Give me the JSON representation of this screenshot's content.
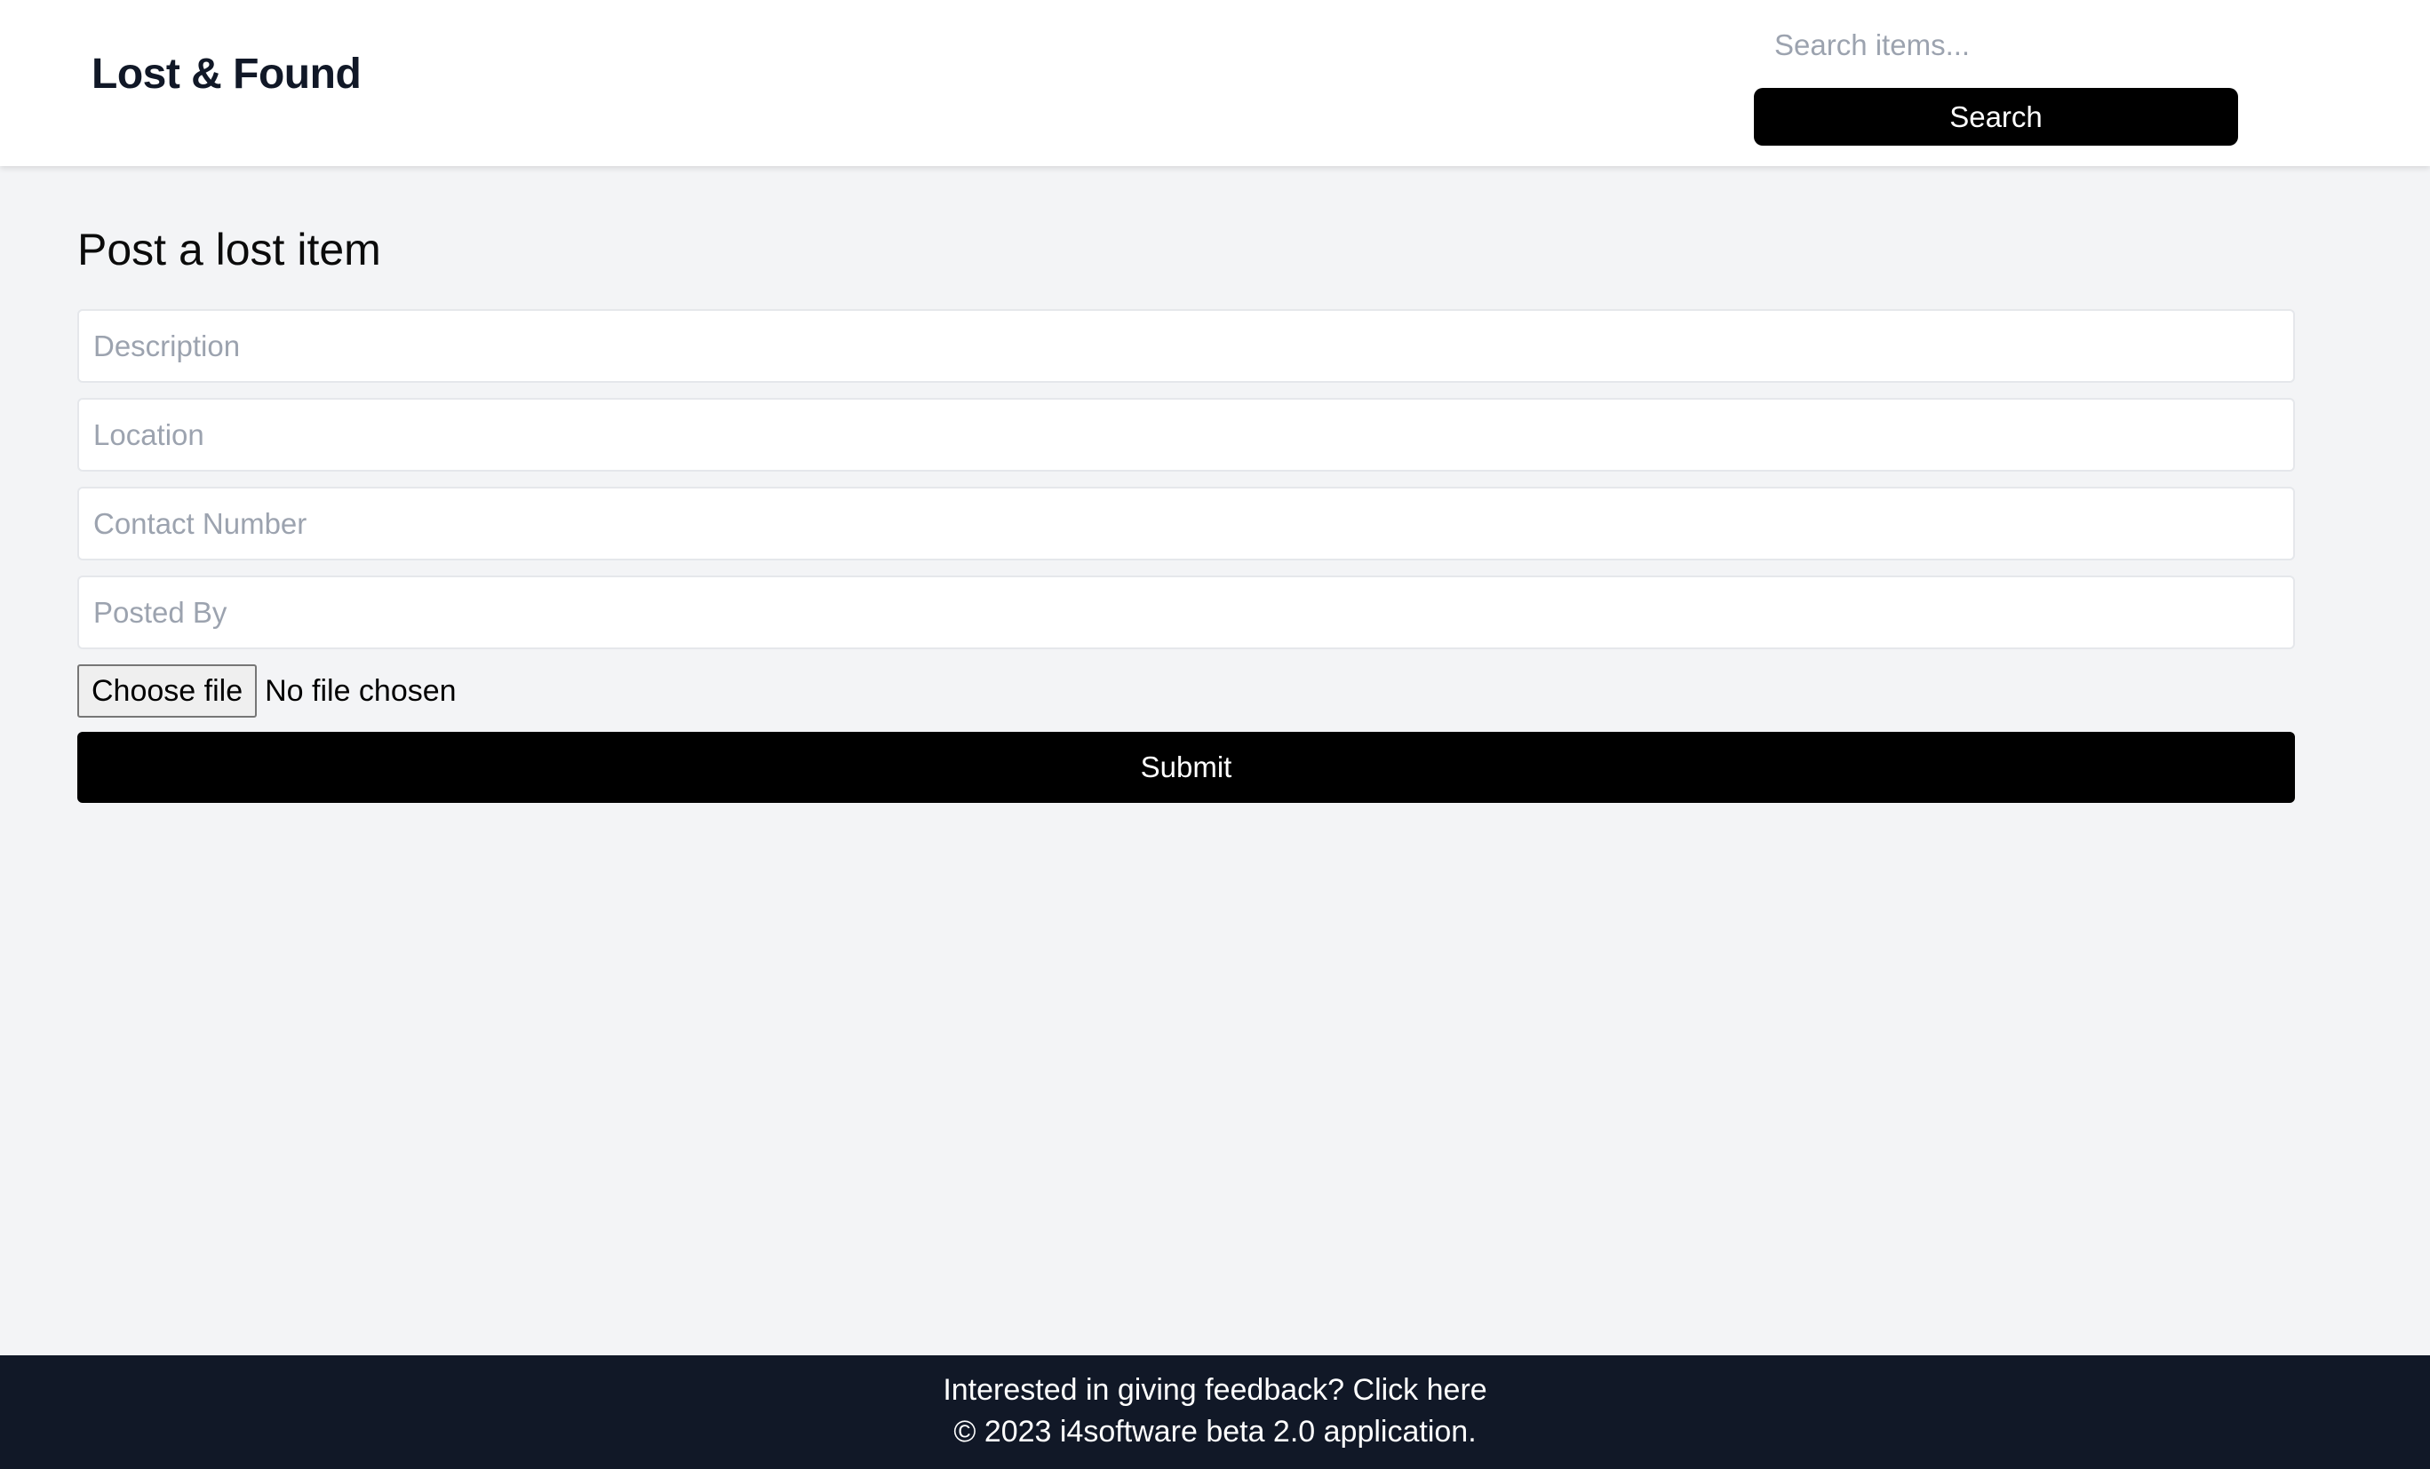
{
  "header": {
    "brand": "Lost & Found",
    "search": {
      "placeholder": "Search items...",
      "value": "",
      "button_label": "Search"
    }
  },
  "form": {
    "title": "Post a lost item",
    "fields": [
      {
        "placeholder": "Description",
        "value": ""
      },
      {
        "placeholder": "Location",
        "value": ""
      },
      {
        "placeholder": "Contact Number",
        "value": ""
      },
      {
        "placeholder": "Posted By",
        "value": ""
      }
    ],
    "file": {
      "button_label": "Choose file",
      "status": "No file chosen"
    },
    "submit_label": "Submit"
  },
  "footer": {
    "feedback_text": "Interested in giving feedback?",
    "feedback_link": "Click here",
    "copyright": "© 2023 i4software beta 2.0 application."
  },
  "colors": {
    "background": "#f3f4f6",
    "header_bg": "#ffffff",
    "button_bg": "#000000",
    "footer_bg": "#111827",
    "placeholder": "#9ca3af"
  }
}
